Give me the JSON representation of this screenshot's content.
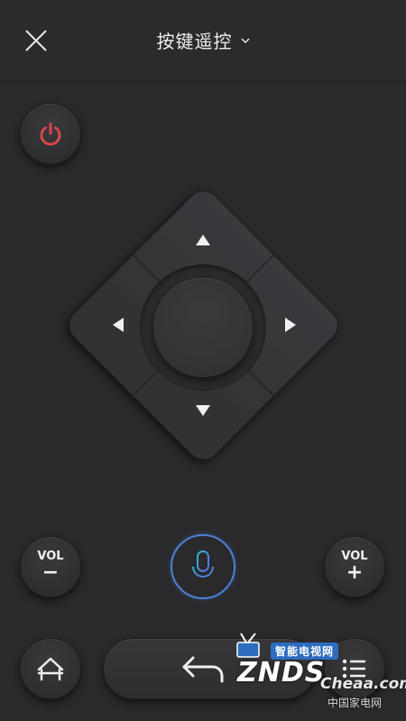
{
  "header": {
    "title": "按键遥控",
    "close_icon": "close-icon",
    "dropdown_icon": "chevron-down-icon"
  },
  "buttons": {
    "power_icon": "power-icon",
    "vol_down_label": "VOL",
    "vol_down_sign": "−",
    "vol_up_label": "VOL",
    "vol_up_sign": "+",
    "mic_icon": "microphone-icon",
    "home_icon": "home-icon",
    "back_icon": "back-arrow-icon",
    "menu_icon": "menu-icon"
  },
  "dpad": {
    "up_icon": "arrow-up-icon",
    "down_icon": "arrow-down-icon",
    "left_icon": "arrow-left-icon",
    "right_icon": "arrow-right-icon",
    "ok_label": ""
  },
  "watermark": {
    "top_text": "智能电视网",
    "logo_text": "ZNDS",
    "site_text": "Cheaa.com",
    "bottom_text": "中国家电网"
  },
  "colors": {
    "background": "#2a2a2c",
    "power_red": "#e0474c",
    "mic_gradient_start": "#2bb6d6",
    "mic_gradient_end": "#5a6fe0"
  }
}
